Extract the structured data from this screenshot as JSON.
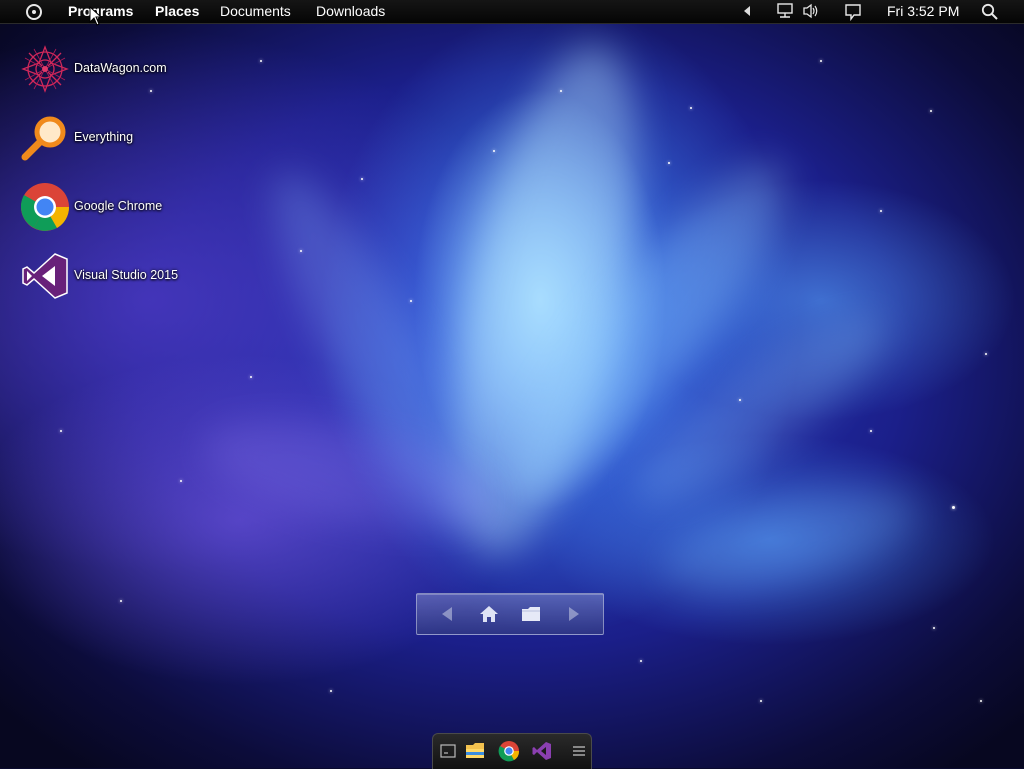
{
  "menubar": {
    "items": [
      {
        "label": "Programs"
      },
      {
        "label": "Places"
      },
      {
        "label": "Documents"
      },
      {
        "label": "Downloads"
      }
    ],
    "clock": "Fri 3:52 PM"
  },
  "desktop": {
    "icons": [
      {
        "label": "DataWagon.com",
        "icon": "datawagon-icon"
      },
      {
        "label": "Everything",
        "icon": "everything-search-icon"
      },
      {
        "label": "Google Chrome",
        "icon": "chrome-icon"
      },
      {
        "label": "Visual Studio 2015",
        "icon": "visual-studio-icon"
      }
    ]
  },
  "navigator": {
    "buttons": [
      "back-icon",
      "home-icon",
      "folder-icon",
      "forward-icon"
    ]
  },
  "dock": {
    "items": [
      "terminal-icon",
      "file-explorer-icon",
      "chrome-icon",
      "visual-studio-icon",
      "menu-icon"
    ]
  },
  "colors": {
    "menubar": "#0a0a0a",
    "everything_orange": "#f08a1c",
    "vs_purple": "#68217a"
  }
}
